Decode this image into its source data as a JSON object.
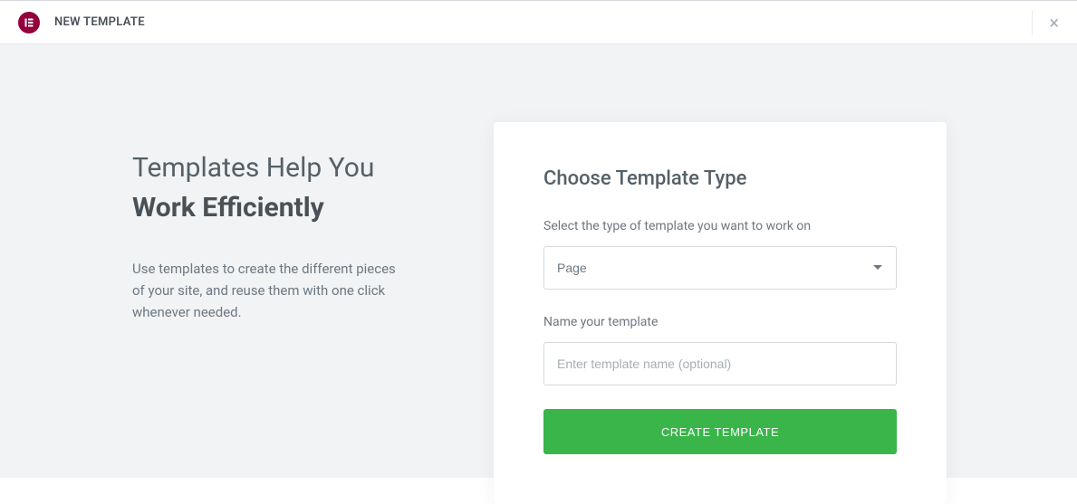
{
  "header": {
    "title": "NEW TEMPLATE"
  },
  "intro": {
    "headline_light": "Templates Help You",
    "headline_bold": "Work Efficiently",
    "description": "Use templates to create the different pieces of your site, and reuse them with one click whenever needed."
  },
  "form": {
    "title": "Choose Template Type",
    "type_label": "Select the type of template you want to work on",
    "type_value": "Page",
    "name_label": "Name your template",
    "name_placeholder": "Enter template name (optional)",
    "submit_label": "CREATE TEMPLATE"
  }
}
